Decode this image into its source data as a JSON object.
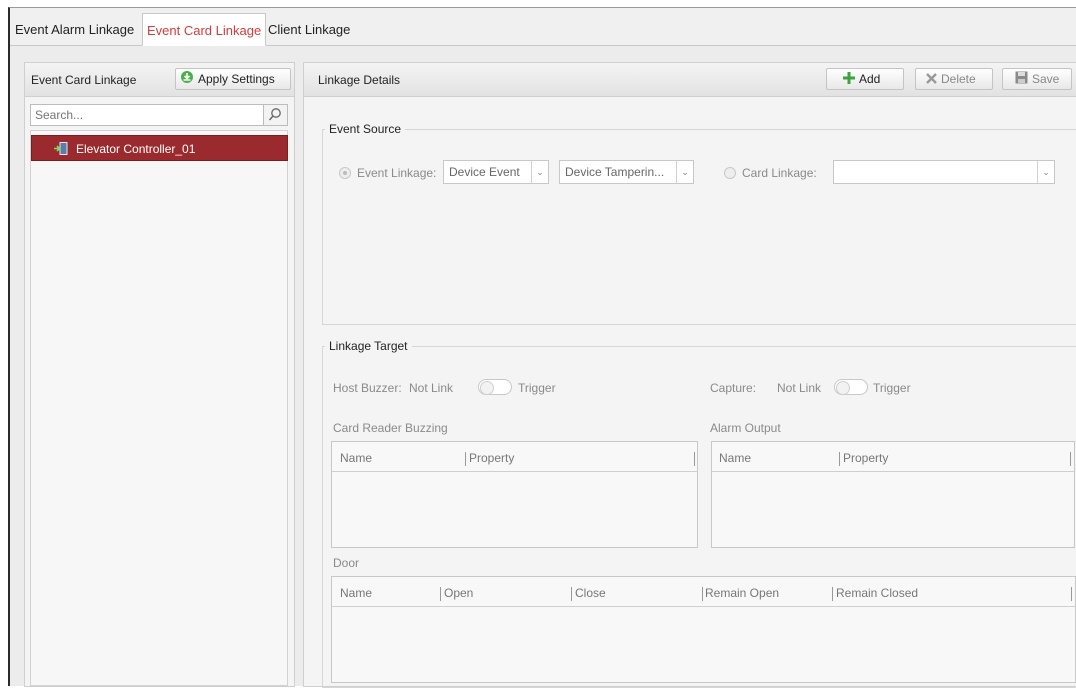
{
  "tabs": [
    "Event Alarm Linkage",
    "Event Card Linkage",
    "Client Linkage"
  ],
  "left": {
    "title": "Event Card Linkage",
    "apply_label": "Apply Settings",
    "search_placeholder": "Search...",
    "tree_items": [
      "Elevator Controller_01"
    ]
  },
  "right": {
    "title": "Linkage Details",
    "add_label": "Add",
    "delete_label": "Delete",
    "save_label": "Save",
    "event_source": {
      "legend": "Event Source",
      "event_linkage_label": "Event Linkage:",
      "event_type": "Device Event",
      "event_detail": "Device Tamperin...",
      "card_linkage_label": "Card Linkage:",
      "card_value": ""
    },
    "linkage_target": {
      "legend": "Linkage Target",
      "host_buzzer_label": "Host Buzzer:",
      "capture_label": "Capture:",
      "not_link": "Not Link",
      "trigger": "Trigger",
      "card_reader_title": "Card Reader Buzzing",
      "alarm_output_title": "Alarm Output",
      "door_title": "Door",
      "card_reader_cols": [
        "Name",
        "Property"
      ],
      "alarm_output_cols": [
        "Name",
        "Property"
      ],
      "door_cols": [
        "Name",
        "Open",
        "Close",
        "Remain Open",
        "Remain Closed"
      ]
    }
  },
  "colors": {
    "active_tab": "#d73a3a",
    "selected_item": "#9a2a2e",
    "add_icon": "#3ea33e"
  }
}
